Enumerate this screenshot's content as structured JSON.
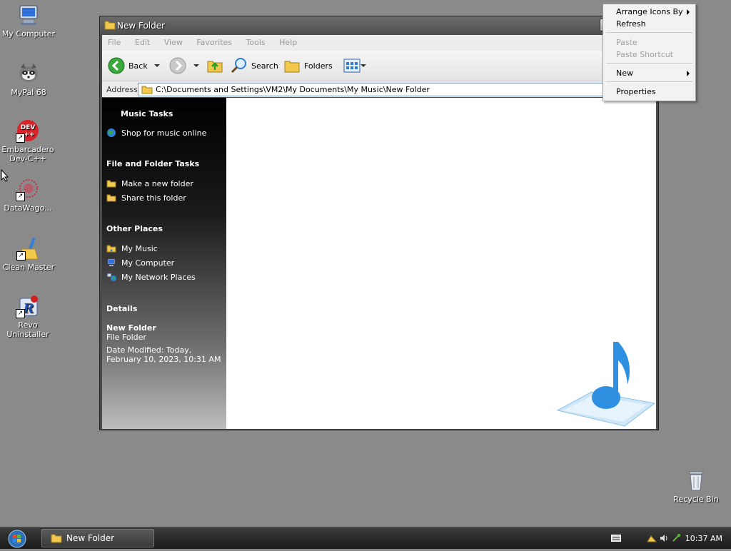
{
  "desktop": {
    "icons": [
      {
        "label": "My Computer"
      },
      {
        "label": "MyPal 68"
      },
      {
        "label": "Embarcadero\nDev-C++",
        "line1": "Embarcadero",
        "line2": "Dev-C++",
        "badge": "DEV\n++"
      },
      {
        "label": "DataWago..."
      },
      {
        "label": "Clean Master"
      },
      {
        "label": "Revo Uninstaller",
        "line1": "Revo",
        "line2": "Uninstaller"
      }
    ],
    "recycle_bin": "Recycle Bin",
    "dev_badge_top": "DEV",
    "dev_badge_bottom": "++"
  },
  "window": {
    "title": "New Folder",
    "menu": [
      "File",
      "Edit",
      "View",
      "Favorites",
      "Tools",
      "Help"
    ],
    "toolbar": {
      "back": "Back",
      "search": "Search",
      "folders": "Folders"
    },
    "address_label": "Address",
    "address_path": "C:\\Documents and Settings\\VM2\\My Documents\\My Music\\New Folder"
  },
  "taskpane": {
    "music_tasks": {
      "title": "Music Tasks",
      "items": [
        "Shop for music online"
      ]
    },
    "file_tasks": {
      "title": "File and Folder Tasks",
      "items": [
        "Make a new folder",
        "Share this folder"
      ]
    },
    "other_places": {
      "title": "Other Places",
      "items": [
        "My Music",
        "My Computer",
        "My Network Places"
      ]
    },
    "details": {
      "title": "Details",
      "name": "New Folder",
      "type": "File Folder",
      "modified_line1": "Date Modified: Today,",
      "modified_line2": "February 10, 2023, 10:31 AM"
    }
  },
  "context_menu": {
    "arrange": "Arrange Icons By",
    "refresh": "Refresh",
    "paste": "Paste",
    "paste_shortcut": "Paste Shortcut",
    "new": "New",
    "properties": "Properties"
  },
  "taskbar": {
    "window_button": "New Folder",
    "clock": "10:37 AM"
  },
  "colors": {
    "desktop": "#8a8a8a",
    "accent_blue": "#2f7fd8",
    "folder_yellow": "#f2c94c"
  }
}
